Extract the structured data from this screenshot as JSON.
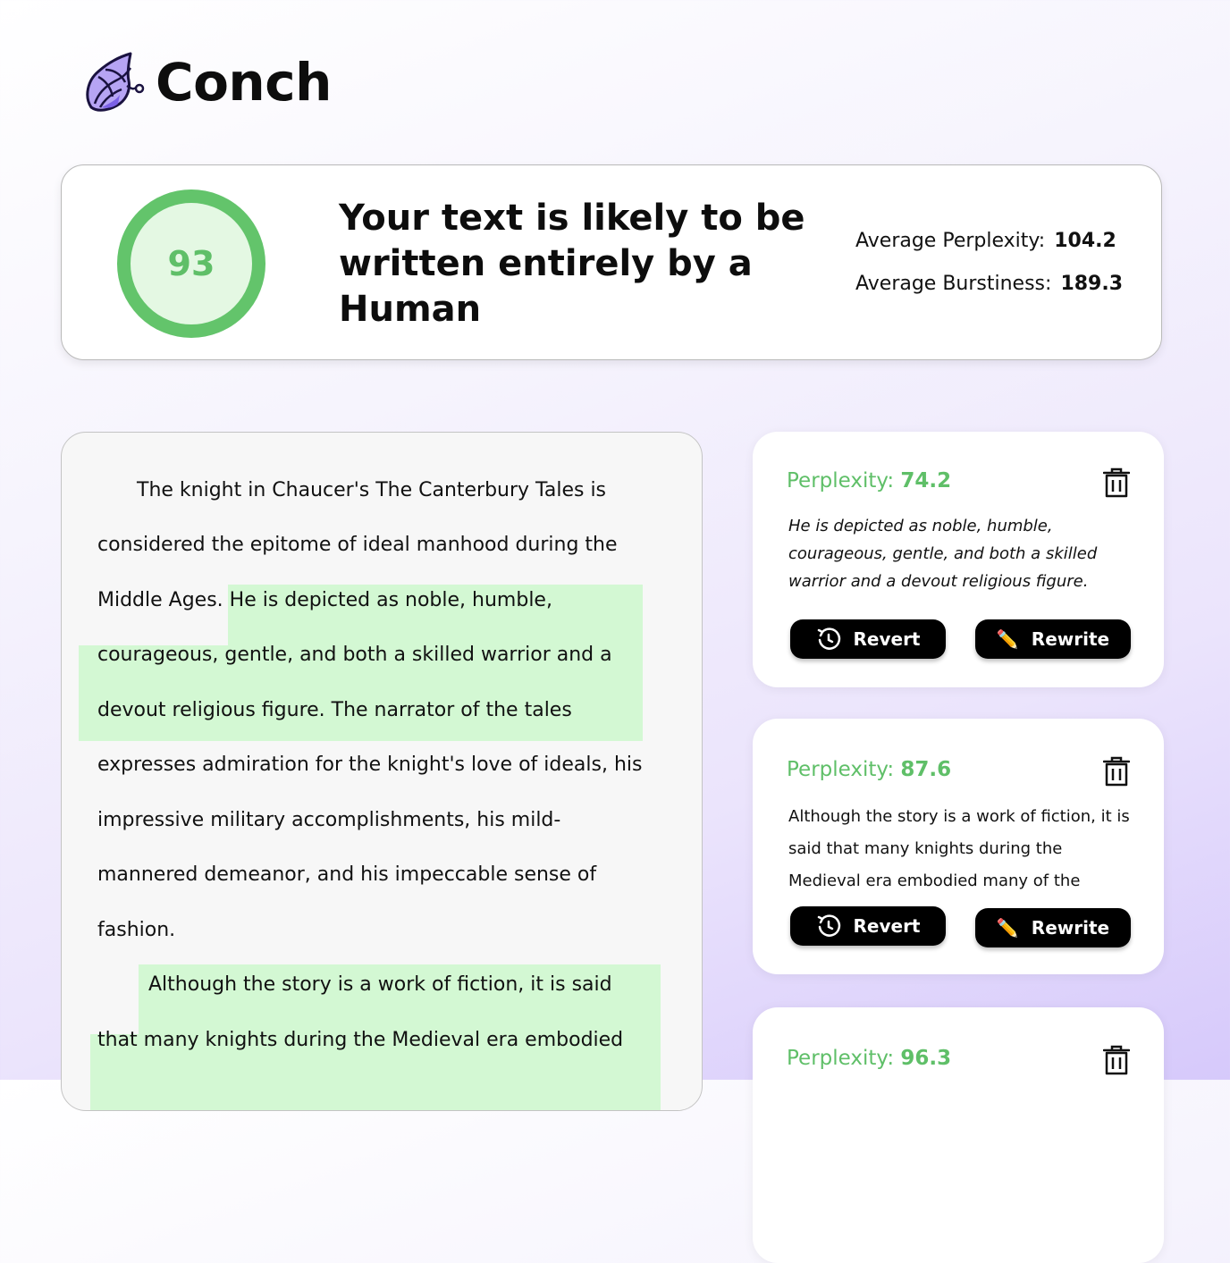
{
  "brand": {
    "name": "Conch",
    "logo_icon": "conch-shell-icon"
  },
  "summary": {
    "score": "93",
    "headline": "Your text is likely to be written entirely by a Human",
    "perplexity_label": "Average Perplexity:",
    "perplexity_value": "104.2",
    "burstiness_label": "Average Burstiness:",
    "burstiness_value": "189.3",
    "score_color": "#63c46b"
  },
  "document": {
    "lines": [
      "The knight in Chaucer's The Canterbury Tales is",
      "considered the epitome of ideal manhood during the",
      "Middle Ages. He is depicted as noble, humble,",
      "courageous, gentle, and both a skilled warrior and a",
      "devout religious figure. The narrator of the tales",
      "expresses admiration for the knight's love of ideals, his",
      "impressive military accomplishments, his mild-",
      "mannered demeanor, and his impeccable sense of",
      "fashion.",
      "Although the story is a work of fiction, it is said",
      "that many knights during the Medieval era embodied"
    ],
    "highlight_color": "#d3f8d3"
  },
  "cards": [
    {
      "perplexity_label": "Perplexity:",
      "perplexity_value": "74.2",
      "text": "He is depicted as noble, humble, courageous, gentle, and both a skilled warrior and a devout religious figure.",
      "revert_label": "Revert",
      "rewrite_label": "Rewrite"
    },
    {
      "perplexity_label": "Perplexity:",
      "perplexity_value": "87.6",
      "text": "Although the story is a work of fiction, it is said that many knights during the Medieval era embodied many of the",
      "revert_label": "Revert",
      "rewrite_label": "Rewrite"
    },
    {
      "perplexity_label": "Perplexity:",
      "perplexity_value": "96.3"
    }
  ],
  "icons": {
    "delete": "trash-icon",
    "revert": "revert-icon",
    "rewrite": "pencil-icon"
  }
}
